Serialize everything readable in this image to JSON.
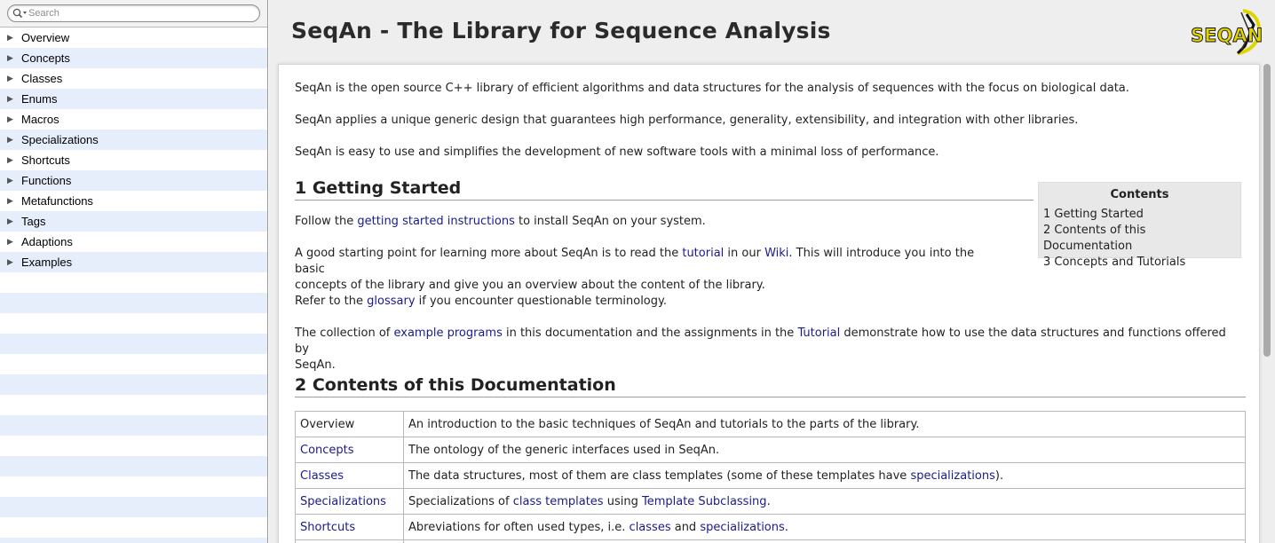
{
  "sidebar": {
    "search": {
      "placeholder": "Search",
      "value": ""
    },
    "items": [
      {
        "label": "Overview"
      },
      {
        "label": "Concepts"
      },
      {
        "label": "Classes"
      },
      {
        "label": "Enums"
      },
      {
        "label": "Macros"
      },
      {
        "label": "Specializations"
      },
      {
        "label": "Shortcuts"
      },
      {
        "label": "Functions"
      },
      {
        "label": "Metafunctions"
      },
      {
        "label": "Tags"
      },
      {
        "label": "Adaptions"
      },
      {
        "label": "Examples"
      }
    ]
  },
  "header": {
    "title": "SeqAn - The Library for Sequence Analysis",
    "logo_text": "SEQAN"
  },
  "intro": {
    "p1": "SeqAn is the open source C++ library of efficient algorithms and data structures for the analysis of sequences with the focus on biological data.",
    "p2": "SeqAn applies a unique generic design that guarantees high performance, generality, extensibility, and integration with other libraries.",
    "p3": "SeqAn is easy to use and simplifies the development of new software tools with a minimal loss of performance."
  },
  "section1": {
    "heading": "1 Getting Started",
    "p1": {
      "before": "Follow the ",
      "link": "getting started instructions",
      "after": " to install SeqAn on your system."
    },
    "p2": {
      "before": "A good starting point for learning more about SeqAn is to read the ",
      "link1": "tutorial",
      "mid": " in our ",
      "link2": "Wiki",
      "after": ". This will introduce you into the basic",
      "line2": "concepts of the library and give you an overview about the content of the library."
    },
    "p3": {
      "before": "Refer to the ",
      "link": "glossary",
      "after": " if you encounter questionable terminology."
    },
    "p4": {
      "before": "The collection of ",
      "link1": "example programs",
      "mid": " in this documentation and the assignments in the ",
      "link2": "Tutorial",
      "after": " demonstrate how to use the data structures and functions offered by",
      "line2": "SeqAn."
    }
  },
  "toc": {
    "title": "Contents",
    "items": [
      {
        "label": "1 Getting Started"
      },
      {
        "label": "2 Contents of this Documentation"
      },
      {
        "label": "3 Concepts and Tutorials"
      }
    ]
  },
  "section2": {
    "heading": "2 Contents of this Documentation",
    "rows": [
      {
        "name": "Overview",
        "desc": "An introduction to the basic techniques of SeqAn and tutorials to the parts of the library."
      },
      {
        "name": "Concepts",
        "desc": "The ontology of the generic interfaces used in SeqAn."
      },
      {
        "name": "Classes",
        "desc_before": "The data structures, most of them are class templates (some of these templates have ",
        "desc_link": "specializations",
        "desc_after": ")."
      },
      {
        "name": "Specializations",
        "desc_before": "Specializations of ",
        "desc_link1": "class templates",
        "desc_mid": " using ",
        "desc_link2": "Template Subclassing",
        "desc_after": "."
      },
      {
        "name": "Shortcuts",
        "desc_before": "Abreviations for often used types, i.e. ",
        "desc_link1": "classes",
        "desc_mid": " and ",
        "desc_link2": "specializations",
        "desc_after": "."
      }
    ]
  },
  "colors": {
    "link": "#1a1a8c",
    "sidebar_stripe": "#e6eefc",
    "main_bg": "#eeeeee"
  }
}
